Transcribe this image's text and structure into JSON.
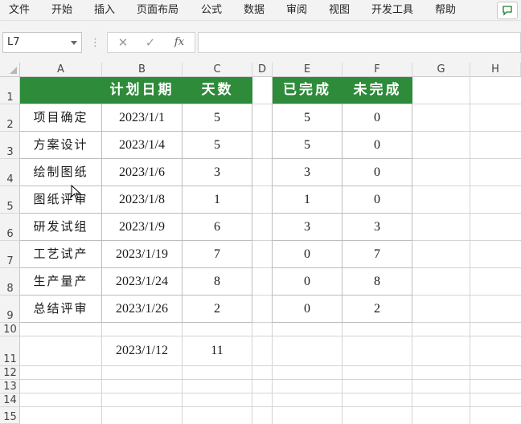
{
  "menu": [
    "文件",
    "开始",
    "插入",
    "页面布局",
    "公式",
    "数据",
    "审阅",
    "视图",
    "开发工具",
    "帮助"
  ],
  "namebox": "L7",
  "formula_buttons": {
    "cancel": "✕",
    "enter": "✓",
    "function": "fx"
  },
  "columns": [
    "A",
    "B",
    "C",
    "D",
    "E",
    "F",
    "G",
    "H"
  ],
  "rows": [
    "1",
    "2",
    "3",
    "4",
    "5",
    "6",
    "7",
    "8",
    "9",
    "10",
    "11",
    "12",
    "13",
    "14",
    "15"
  ],
  "header": {
    "plan_date": "计划日期",
    "days": "天数",
    "done": "已完成",
    "undone": "未完成"
  },
  "table": [
    {
      "task": "项目确定",
      "date": "2023/1/1",
      "days": "5",
      "done": "5",
      "undone": "0"
    },
    {
      "task": "方案设计",
      "date": "2023/1/4",
      "days": "5",
      "done": "5",
      "undone": "0"
    },
    {
      "task": "绘制图纸",
      "date": "2023/1/6",
      "days": "3",
      "done": "3",
      "undone": "0"
    },
    {
      "task": "图纸评审",
      "date": "2023/1/8",
      "days": "1",
      "done": "1",
      "undone": "0"
    },
    {
      "task": "研发试组",
      "date": "2023/1/9",
      "days": "6",
      "done": "3",
      "undone": "3"
    },
    {
      "task": "工艺试产",
      "date": "2023/1/19",
      "days": "7",
      "done": "0",
      "undone": "7"
    },
    {
      "task": "生产量产",
      "date": "2023/1/24",
      "days": "8",
      "done": "0",
      "undone": "8"
    },
    {
      "task": "总结评审",
      "date": "2023/1/26",
      "days": "2",
      "done": "0",
      "undone": "2"
    }
  ],
  "row11": {
    "date": "2023/1/12",
    "days": "11"
  },
  "colors": {
    "header_green": "#2e8b3a"
  }
}
